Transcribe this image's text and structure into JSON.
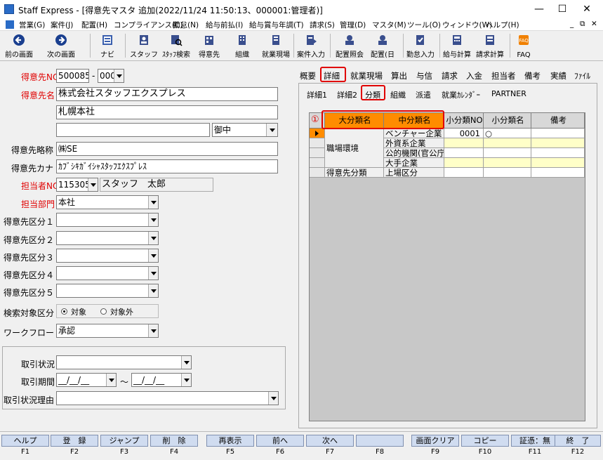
{
  "window": {
    "title": "Staff Express - [得意先マスタ 追加(2022/11/24 11:50:13、000001:管理者)]",
    "min": "—",
    "max": "☐",
    "close": "✕",
    "inner_min": "_",
    "inner_restore": "⧉",
    "inner_close": "✕"
  },
  "menu": [
    "営業(G)",
    "案件(J)",
    "配置(H)",
    "コンプライアンス(C)",
    "勤怠(N)",
    "給与前払(I)",
    "給与賞与年調(T)",
    "請求(S)",
    "管理(D)",
    "マスタ(M)",
    "ツール(O)",
    "ウィンドウ(W)",
    "ヘルプ(H)"
  ],
  "toolbar": {
    "prev": "前の画面",
    "next": "次の画面",
    "navi": "ナビ",
    "staff": "スタッフ",
    "staff_search": "ｽﾀｯﾌ検索",
    "client": "得意先",
    "org": "組織",
    "site": "就業現場",
    "case_input": "案件入力",
    "assign_inquiry": "配置照会",
    "assign_day": "配置(日",
    "attendance": "勤怠入力",
    "payroll": "給与計算",
    "billing": "請求計算",
    "faq": "FAQ"
  },
  "form": {
    "client_no_label": "得意先NO",
    "client_no": "500085",
    "client_no_sep": "-",
    "client_no_sub": "000",
    "client_name_label": "得意先名",
    "client_name": "株式会社スタッフエクスプレス",
    "client_name2": "札幌本社",
    "client_name3": "",
    "honorific": "御中",
    "short_name_label": "得意先略称",
    "short_name": "㈱SE",
    "kana_label": "得意先カナ",
    "kana": "ｶﾌﾞｼｷｶﾞｲｼｬｽﾀｯﾌｴｸｽﾌﾟﾚｽ",
    "staff_no_label": "担当者NO",
    "staff_no": "115305",
    "staff_name": "スタッフ　太郎",
    "dept_label": "担当部門",
    "dept": "本社",
    "cat1_label": "得意先区分１",
    "cat2_label": "得意先区分２",
    "cat3_label": "得意先区分３",
    "cat4_label": "得意先区分４",
    "cat5_label": "得意先区分５",
    "search_label": "検索対象区分",
    "search_opt1": "対象",
    "search_opt2": "対象外",
    "workflow_label": "ワークフロー",
    "workflow": "承認",
    "deal_status_label": "取引状況",
    "deal_period_label": "取引期間",
    "date_placeholder": "__/__/__",
    "tilde": "～",
    "deal_reason_label": "取引状況理由"
  },
  "tabs1": [
    "概要",
    "詳細",
    "就業現場",
    "算出",
    "与信",
    "請求",
    "入金",
    "担当者",
    "備考",
    "実績",
    "ﾌｧｲﾙ"
  ],
  "tabs2": [
    "詳細1",
    "詳細2",
    "分類",
    "組織",
    "派遣",
    "就業ｶﾚﾝﾀﾞｰ",
    "PARTNER"
  ],
  "grid": {
    "marker": "①",
    "headers": [
      "大分類名",
      "中分類名",
      "小分類NO",
      "小分類名",
      "備考"
    ],
    "rows": [
      {
        "major": "職場環境",
        "mid": "ベンチャー企業",
        "no": "0001",
        "small": "○",
        "note": ""
      },
      {
        "major": "",
        "mid": "外資系企業",
        "no": "",
        "small": "",
        "note": ""
      },
      {
        "major": "",
        "mid": "公的機関(官公庁",
        "no": "",
        "small": "",
        "note": ""
      },
      {
        "major": "",
        "mid": "大手企業",
        "no": "",
        "small": "",
        "note": ""
      },
      {
        "major": "得意先分類",
        "mid": "上場区分",
        "no": "",
        "small": "",
        "note": ""
      }
    ]
  },
  "fkeys": [
    {
      "label": "ヘルプ",
      "key": "F1"
    },
    {
      "label": "登　録",
      "key": "F2"
    },
    {
      "label": "ジャンプ",
      "key": "F3"
    },
    {
      "label": "削　除",
      "key": "F4"
    },
    {
      "label": "再表示",
      "key": "F5"
    },
    {
      "label": "前へ",
      "key": "F6"
    },
    {
      "label": "次へ",
      "key": "F7"
    },
    {
      "label": "",
      "key": "F8"
    },
    {
      "label": "画面クリア",
      "key": "F9"
    },
    {
      "label": "コピー",
      "key": "F10"
    },
    {
      "label": "証憑：無",
      "key": "F11"
    },
    {
      "label": "終　了",
      "key": "F12"
    }
  ],
  "colors": {
    "accent_red": "#e00000",
    "header_orange": "#ff8c00",
    "highlight_yellow": "#ffffc8"
  }
}
